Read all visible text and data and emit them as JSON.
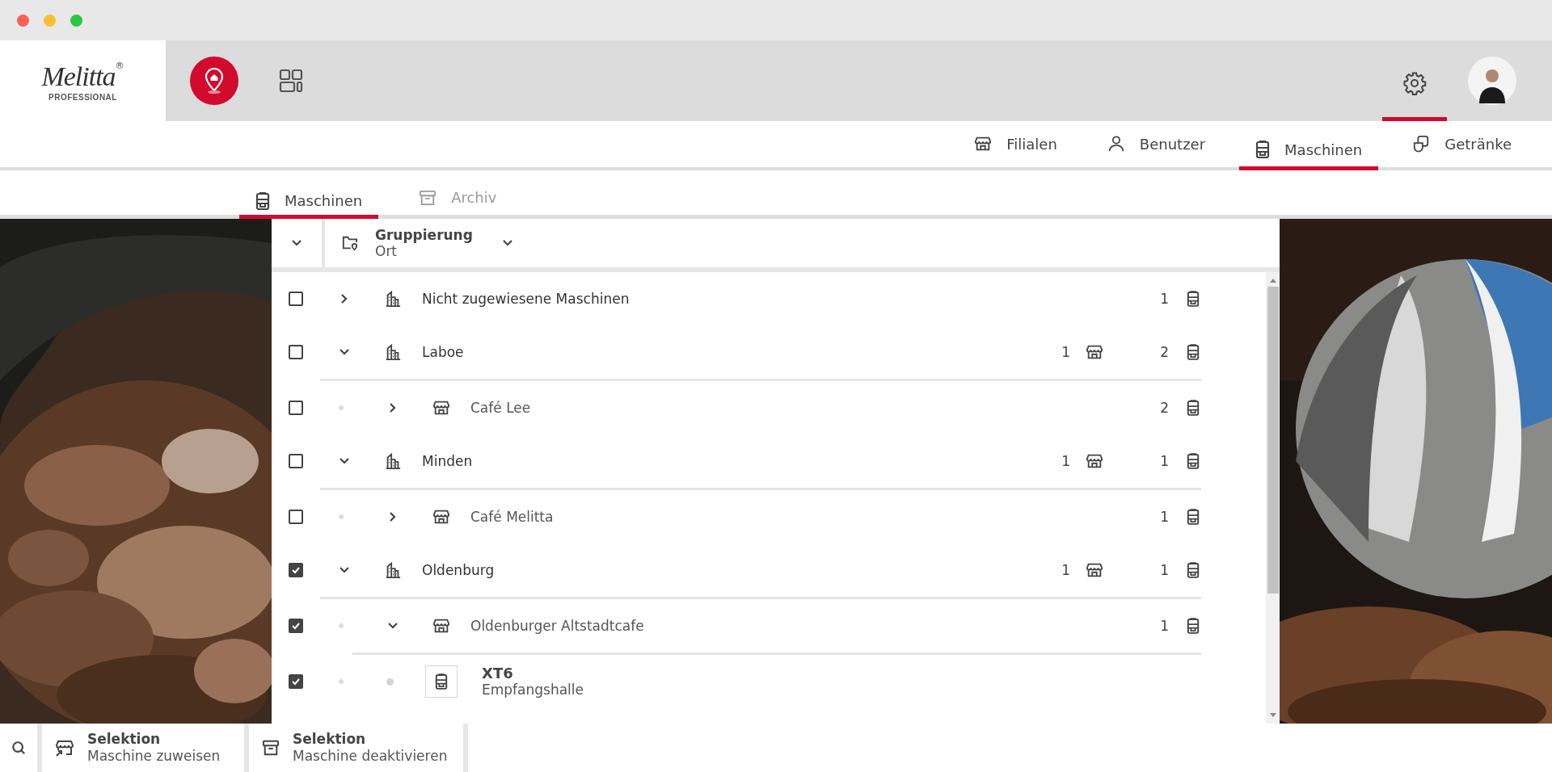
{
  "logo": {
    "wordmark": "Melitta",
    "mark": "®",
    "tagline": "PROFESSIONAL"
  },
  "header": {
    "settings_selected": true
  },
  "nav_tabs": [
    {
      "label": "Filialen",
      "kind": "store",
      "selected": false
    },
    {
      "label": "Benutzer",
      "kind": "user",
      "selected": false
    },
    {
      "label": "Maschinen",
      "kind": "machine",
      "selected": true
    },
    {
      "label": "Getränke",
      "kind": "drink",
      "selected": false
    }
  ],
  "sub_tabs": [
    {
      "label": "Maschinen",
      "kind": "machine",
      "selected": true
    },
    {
      "label": "Archiv",
      "kind": "archive",
      "selected": false
    }
  ],
  "grouping": {
    "label": "Gruppierung",
    "value": "Ort"
  },
  "tree": [
    {
      "kind": "location",
      "label": "Nicht zugewiesene Maschinen",
      "checked": false,
      "expanded": false,
      "machine_count": "1"
    },
    {
      "kind": "location",
      "label": "Laboe",
      "checked": false,
      "expanded": true,
      "store_count": "1",
      "machine_count": "2",
      "children": [
        {
          "kind": "store",
          "label": "Café Lee",
          "checked": false,
          "expanded": false,
          "machine_count": "2"
        }
      ]
    },
    {
      "kind": "location",
      "label": "Minden",
      "checked": false,
      "expanded": true,
      "store_count": "1",
      "machine_count": "1",
      "children": [
        {
          "kind": "store",
          "label": "Café Melitta",
          "checked": false,
          "expanded": false,
          "machine_count": "1"
        }
      ]
    },
    {
      "kind": "location",
      "label": "Oldenburg",
      "checked": true,
      "expanded": true,
      "store_count": "1",
      "machine_count": "1",
      "children": [
        {
          "kind": "store",
          "label": "Oldenburger Altstadtcafe",
          "checked": true,
          "expanded": true,
          "machine_count": "1",
          "children": [
            {
              "kind": "machine",
              "label": "XT6",
              "sublabel": "Empfangshalle",
              "checked": true
            }
          ]
        }
      ]
    }
  ],
  "actions": [
    {
      "kind": "assign",
      "title": "Selektion",
      "label": "Maschine zuweisen"
    },
    {
      "kind": "archive",
      "title": "Selektion",
      "label": "Maschine deaktivieren"
    }
  ]
}
